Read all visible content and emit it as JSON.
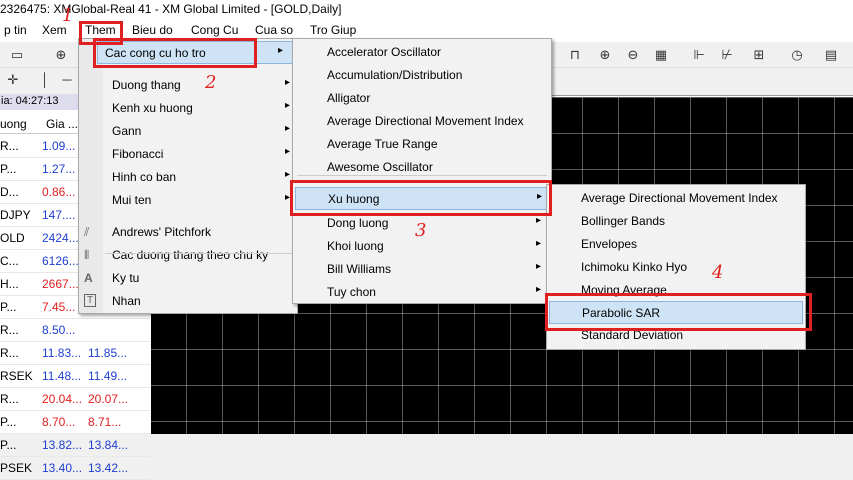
{
  "window": {
    "title": "2326475: XMGlobal-Real 41 - XM Global Limited - [GOLD,Daily]"
  },
  "menubar": {
    "items": [
      "p tin",
      "Xem",
      "Them",
      "Bieu do",
      "Cong Cu",
      "Cua so",
      "Tro Giup"
    ]
  },
  "market_watch": {
    "time_label": "ia: 04:27:13",
    "col_symbol": "uong",
    "col_bid": "Gia ...",
    "rows": [
      {
        "symbol": "R...",
        "bid": "1.09...",
        "ask": "",
        "bid_color": "blue"
      },
      {
        "symbol": "P...",
        "bid": "1.27...",
        "ask": "",
        "bid_color": "blue"
      },
      {
        "symbol": "D...",
        "bid": "0.86...",
        "ask": "",
        "bid_color": "red"
      },
      {
        "symbol": "DJPY",
        "bid": "147....",
        "ask": "",
        "bid_color": "blue"
      },
      {
        "symbol": "OLD",
        "bid": "2424...",
        "ask": "",
        "bid_color": "blue"
      },
      {
        "symbol": "C...",
        "bid": "6126...",
        "ask": "",
        "bid_color": "blue"
      },
      {
        "symbol": "H...",
        "bid": "2667...",
        "ask": "",
        "bid_color": "red"
      },
      {
        "symbol": "P...",
        "bid": "7.45...",
        "ask": "",
        "bid_color": "red"
      },
      {
        "symbol": "R...",
        "bid": "8.50...",
        "ask": "",
        "bid_color": "blue"
      },
      {
        "symbol": "R...",
        "bid": "11.83...",
        "ask": "11.85...",
        "bid_color": "blue"
      },
      {
        "symbol": "RSEK",
        "bid": "11.48...",
        "ask": "11.49...",
        "bid_color": "blue"
      },
      {
        "symbol": "R...",
        "bid": "20.04...",
        "ask": "20.07...",
        "bid_color": "red"
      },
      {
        "symbol": "P...",
        "bid": "8.70...",
        "ask": "8.71...",
        "bid_color": "red"
      },
      {
        "symbol": "P...",
        "bid": "13.82...",
        "ask": "13.84...",
        "bid_color": "blue"
      },
      {
        "symbol": "PSEK",
        "bid": "13.40...",
        "ask": "13.42...",
        "bid_color": "blue"
      }
    ]
  },
  "menu_them": {
    "items": [
      {
        "label": "Cac cong cu ho tro",
        "arrow": "▸"
      },
      {
        "label": "Duong thang",
        "arrow": "▸"
      },
      {
        "label": "Kenh xu huong",
        "arrow": "▸"
      },
      {
        "label": "Gann",
        "arrow": "▸"
      },
      {
        "label": "Fibonacci",
        "arrow": "▸"
      },
      {
        "label": "Hinh co ban",
        "arrow": "▸"
      },
      {
        "label": "Mui ten",
        "arrow": "▸"
      },
      {
        "label": "Andrews' Pitchfork",
        "arrow": ""
      },
      {
        "label": "Cac duong thang theo chu ky",
        "arrow": ""
      },
      {
        "label": "Ky tu",
        "arrow": ""
      },
      {
        "label": "Nhan",
        "arrow": ""
      }
    ]
  },
  "menu_indicators": {
    "items": [
      {
        "label": "Accelerator Oscillator",
        "arrow": ""
      },
      {
        "label": "Accumulation/Distribution",
        "arrow": ""
      },
      {
        "label": "Alligator",
        "arrow": ""
      },
      {
        "label": "Average Directional Movement Index",
        "arrow": ""
      },
      {
        "label": "Average True Range",
        "arrow": ""
      },
      {
        "label": "Awesome Oscillator",
        "arrow": ""
      },
      {
        "label": "Xu huong",
        "arrow": "▸"
      },
      {
        "label": "Dong luong",
        "arrow": "▸"
      },
      {
        "label": "Khoi luong",
        "arrow": "▸"
      },
      {
        "label": "Bill Williams",
        "arrow": "▸"
      },
      {
        "label": "Tuy chon",
        "arrow": "▸"
      }
    ]
  },
  "menu_trend": {
    "items": [
      {
        "label": "Average Directional Movement Index"
      },
      {
        "label": "Bollinger Bands"
      },
      {
        "label": "Envelopes"
      },
      {
        "label": "Ichimoku Kinko Hyo"
      },
      {
        "label": "Moving Average"
      },
      {
        "label": "Parabolic SAR"
      },
      {
        "label": "Standard Deviation"
      }
    ]
  },
  "annotations": {
    "step1": "1",
    "step2": "2",
    "step3": "3",
    "step4": "4"
  },
  "colors": {
    "highlight": "#cfe3f6",
    "annotation_red": "#e02020",
    "chart_bg": "#000000"
  }
}
